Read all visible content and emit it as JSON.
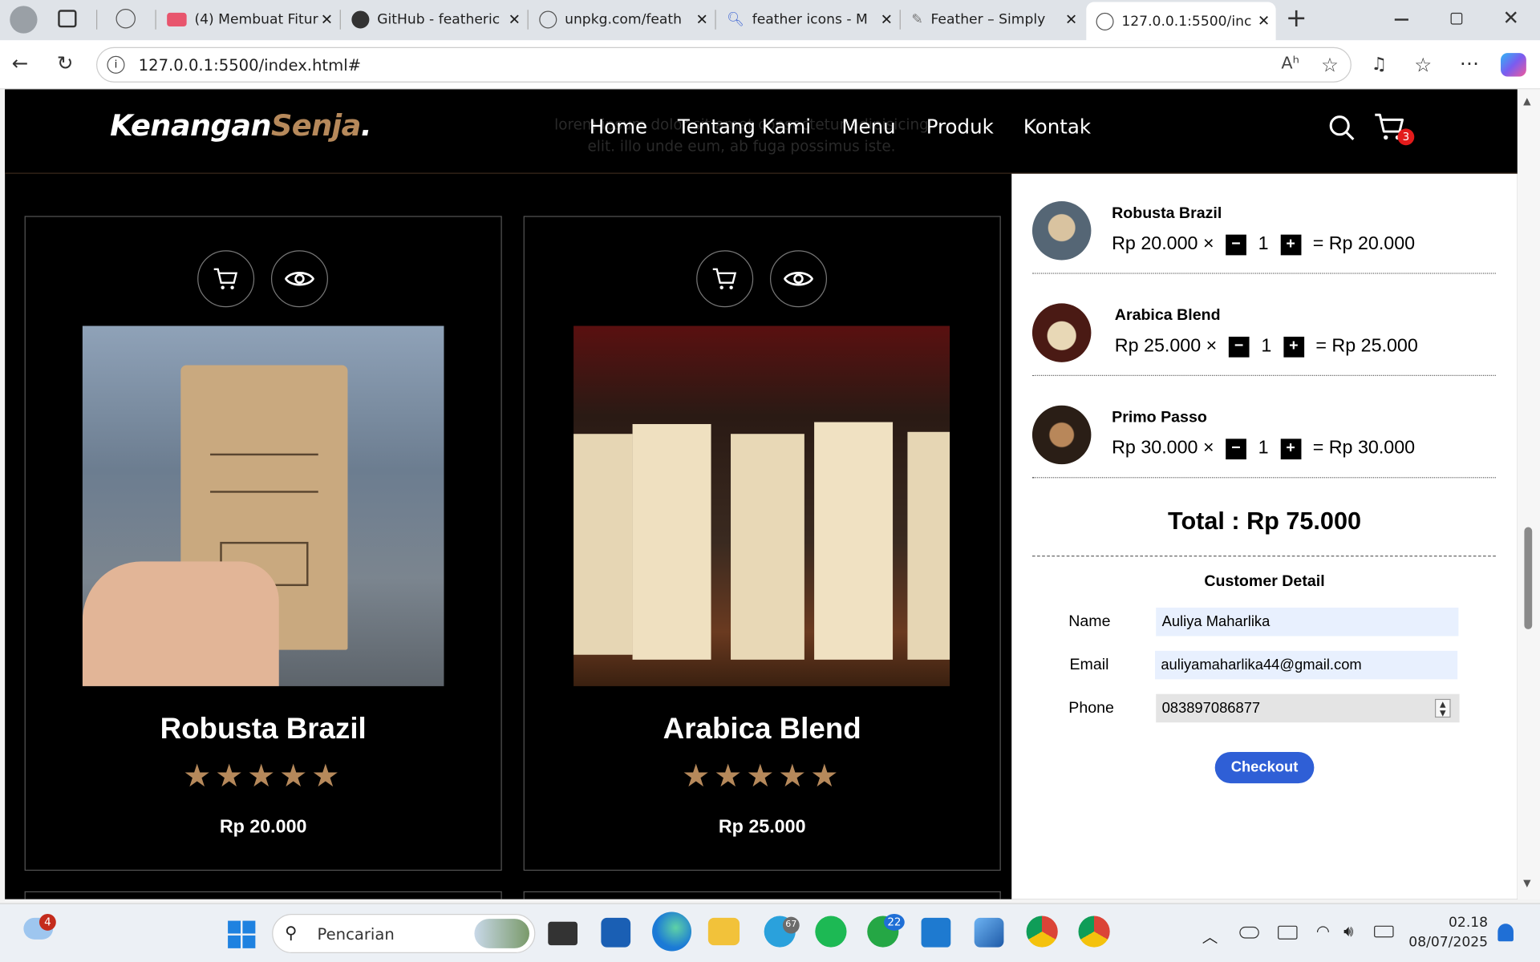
{
  "browser": {
    "tabs": [
      {
        "label": "(4) Membuat Fitur"
      },
      {
        "label": "GitHub - featheric"
      },
      {
        "label": "unpkg.com/feath"
      },
      {
        "label": "feather icons - M"
      },
      {
        "label": "Feather – Simply"
      },
      {
        "label": "127.0.0.1:5500/inc"
      }
    ],
    "url": "127.0.0.1:5500/index.html#",
    "icons": [
      "profile-icon",
      "tab-actions-icon",
      "globe-icon",
      "close-icon",
      "new-tab-icon",
      "minimize-icon",
      "restore-icon",
      "back-icon",
      "reload-icon",
      "info-icon",
      "read-aloud-icon",
      "favorite-icon",
      "collections-icon",
      "favorites-icon",
      "more-icon",
      "copilot-icon"
    ]
  },
  "site": {
    "logo_main": "Kenangan",
    "logo_accent": "Senja",
    "logo_dot": ".",
    "nav": [
      "Home",
      "Tentang Kami",
      "Menu",
      "Produk",
      "Kontak"
    ],
    "ghost_text": "lorem ipsum dolor sit amet consectetur adipisicing elit. illo unde eum, ab fuga possimus iste.",
    "cart_count": "3",
    "accent": "#b6895b"
  },
  "products": [
    {
      "name": "Robusta Brazil",
      "stars": "★★★★★",
      "price": "Rp 20.000"
    },
    {
      "name": "Arabica Blend",
      "stars": "★★★★★",
      "price": "Rp 25.000"
    }
  ],
  "cart": {
    "items": [
      {
        "name": "Robusta Brazil",
        "unit": "Rp 20.000 ×",
        "qty": "1",
        "subtotal": "= Rp 20.000"
      },
      {
        "name": "Arabica Blend",
        "unit": "Rp 25.000 ×",
        "qty": "1",
        "subtotal": "= Rp 25.000"
      },
      {
        "name": "Primo Passo",
        "unit": "Rp 30.000 ×",
        "qty": "1",
        "subtotal": "= Rp 30.000"
      }
    ],
    "minus": "−",
    "plus": "+",
    "total": "Total : Rp 75.000",
    "customer_heading": "Customer Detail",
    "name_label": "Name",
    "name_value": "Auliya Maharlika",
    "email_label": "Email",
    "email_value": "auliyamaharlika44@gmail.com",
    "phone_label": "Phone",
    "phone_value": "083897086877",
    "checkout": "Checkout",
    "checkout_color": "#2f5fd6"
  },
  "taskbar": {
    "weather_badge": "4",
    "search_placeholder": "Pencarian",
    "telegram_badge": "67",
    "whatsapp_badge": "22",
    "time": "02.18",
    "date": "08/07/2025"
  }
}
